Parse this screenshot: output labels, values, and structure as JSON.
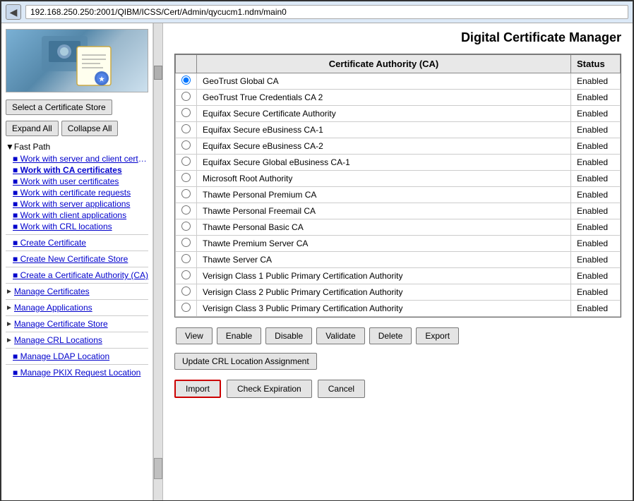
{
  "browser": {
    "back_label": "◀",
    "url": "192.168.250.250:2001/QIBM/ICSS/Cert/Admin/qycucm1.ndm/main0"
  },
  "page": {
    "title": "Digital Certificate Manager"
  },
  "sidebar": {
    "select_store_label": "Select a Certificate Store",
    "expand_all_label": "Expand All",
    "collapse_all_label": "Collapse All",
    "fast_path_label": "▼Fast Path",
    "nav_items": [
      {
        "id": "work-server-client",
        "label": "Work with server and client certificates",
        "bold": false
      },
      {
        "id": "work-ca-certs",
        "label": "Work with CA certificates",
        "bold": true
      },
      {
        "id": "work-user-certs",
        "label": "Work with user certificates",
        "bold": false
      },
      {
        "id": "work-cert-requests",
        "label": "Work with certificate requests",
        "bold": false
      },
      {
        "id": "work-server-apps",
        "label": "Work with server applications",
        "bold": false
      },
      {
        "id": "work-client-apps",
        "label": "Work with client applications",
        "bold": false
      },
      {
        "id": "work-crl-locations",
        "label": "Work with CRL locations",
        "bold": false
      }
    ],
    "section_links": [
      {
        "id": "create-cert",
        "label": "Create Certificate"
      },
      {
        "id": "create-new-store",
        "label": "Create New Certificate Store"
      },
      {
        "id": "create-ca",
        "label": "Create a Certificate Authority (CA)"
      },
      {
        "id": "manage-certs",
        "label": "Manage Certificates",
        "arrow": true
      },
      {
        "id": "manage-apps",
        "label": "Manage Applications",
        "arrow": true
      },
      {
        "id": "manage-cert-store",
        "label": "Manage Certificate Store",
        "arrow": true
      },
      {
        "id": "manage-crl",
        "label": "Manage CRL Locations",
        "arrow": true
      },
      {
        "id": "manage-ldap",
        "label": "Manage LDAP Location"
      },
      {
        "id": "manage-pkix",
        "label": "Manage PKIX Request Location"
      }
    ]
  },
  "table": {
    "col_ca": "Certificate Authority (CA)",
    "col_status": "Status",
    "rows": [
      {
        "id": 1,
        "ca": "GeoTrust Global CA",
        "status": "Enabled",
        "selected": true
      },
      {
        "id": 2,
        "ca": "GeoTrust True Credentials CA 2",
        "status": "Enabled",
        "selected": false
      },
      {
        "id": 3,
        "ca": "Equifax Secure Certificate Authority",
        "status": "Enabled",
        "selected": false
      },
      {
        "id": 4,
        "ca": "Equifax Secure eBusiness CA-1",
        "status": "Enabled",
        "selected": false
      },
      {
        "id": 5,
        "ca": "Equifax Secure eBusiness CA-2",
        "status": "Enabled",
        "selected": false
      },
      {
        "id": 6,
        "ca": "Equifax Secure Global eBusiness CA-1",
        "status": "Enabled",
        "selected": false
      },
      {
        "id": 7,
        "ca": "Microsoft Root Authority",
        "status": "Enabled",
        "selected": false
      },
      {
        "id": 8,
        "ca": "Thawte Personal Premium CA",
        "status": "Enabled",
        "selected": false
      },
      {
        "id": 9,
        "ca": "Thawte Personal Freemail CA",
        "status": "Enabled",
        "selected": false
      },
      {
        "id": 10,
        "ca": "Thawte Personal Basic CA",
        "status": "Enabled",
        "selected": false
      },
      {
        "id": 11,
        "ca": "Thawte Premium Server CA",
        "status": "Enabled",
        "selected": false
      },
      {
        "id": 12,
        "ca": "Thawte Server CA",
        "status": "Enabled",
        "selected": false
      },
      {
        "id": 13,
        "ca": "Verisign Class 1 Public Primary Certification Authority",
        "status": "Enabled",
        "selected": false
      },
      {
        "id": 14,
        "ca": "Verisign Class 2 Public Primary Certification Authority",
        "status": "Enabled",
        "selected": false
      },
      {
        "id": 15,
        "ca": "Verisign Class 3 Public Primary Certification Authority",
        "status": "Enabled",
        "selected": false
      }
    ]
  },
  "action_buttons": {
    "view": "View",
    "enable": "Enable",
    "disable": "Disable",
    "validate": "Validate",
    "delete": "Delete",
    "export": "Export"
  },
  "update_crl_label": "Update CRL Location Assignment",
  "bottom_buttons": {
    "import": "Import",
    "check_expiration": "Check Expiration",
    "cancel": "Cancel"
  }
}
